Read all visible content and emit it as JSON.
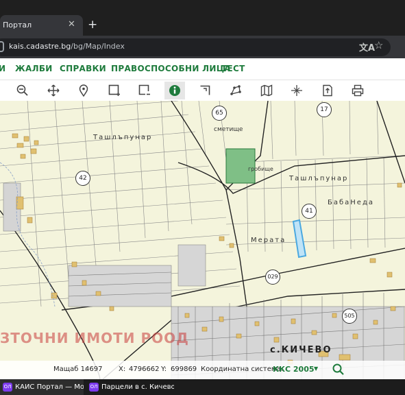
{
  "browser": {
    "tab_title": "Портал",
    "tab_close": "✕",
    "new_tab": "+",
    "url_host": "kais.cadastre.bg",
    "url_path": "/bg/Map/Index"
  },
  "menu": {
    "items": [
      "И",
      "ЖАЛБИ",
      "СПРАВКИ",
      "ПРАВОСПОСОБНИ ЛИЦА",
      "ТЕСТ"
    ]
  },
  "toolbar": {
    "tools": [
      "zoom-out-icon",
      "pan-icon",
      "location-pin-icon",
      "select-rectangle-icon",
      "select-remove-icon",
      "info-icon",
      "corner-select-icon",
      "polygon-icon",
      "map-book-icon",
      "crosshair-icon",
      "export-icon",
      "print-icon"
    ],
    "active_tool": "info-icon"
  },
  "map": {
    "labels": {
      "tashlapunar_w": "Ташлъпунар",
      "tashlapunar_e": "Ташлъпунар",
      "babaneda": "БабаНеда",
      "merata": "Мерата",
      "smetishte": "сметище",
      "grobishte": "гробище",
      "village": "с.КИЧЕВО"
    },
    "parcels": [
      "65",
      "17",
      "42",
      "41",
      "029",
      "505"
    ],
    "watermark": "ЗТОЧНИ ИМОТИ РООД",
    "colors": {
      "background": "#f4f4dc",
      "cemetery": "#7fbf86",
      "highlight": "#4aa8e0",
      "building": "#e0c070"
    }
  },
  "status": {
    "scale_label": "Мащаб 1:",
    "scale_value": "4697",
    "x_label": "X:",
    "x_value": "4796662",
    "y_label": "Y:",
    "y_value": "699869",
    "crs_label": "Координатна система:",
    "crs_value": "ККС 2005"
  },
  "taskbar": {
    "items": [
      {
        "label": "КАИС Портал — Мо...",
        "icon": "ОЛ"
      },
      {
        "label": "Парцели в с. Кичево...",
        "icon": "ОЛ"
      }
    ]
  }
}
